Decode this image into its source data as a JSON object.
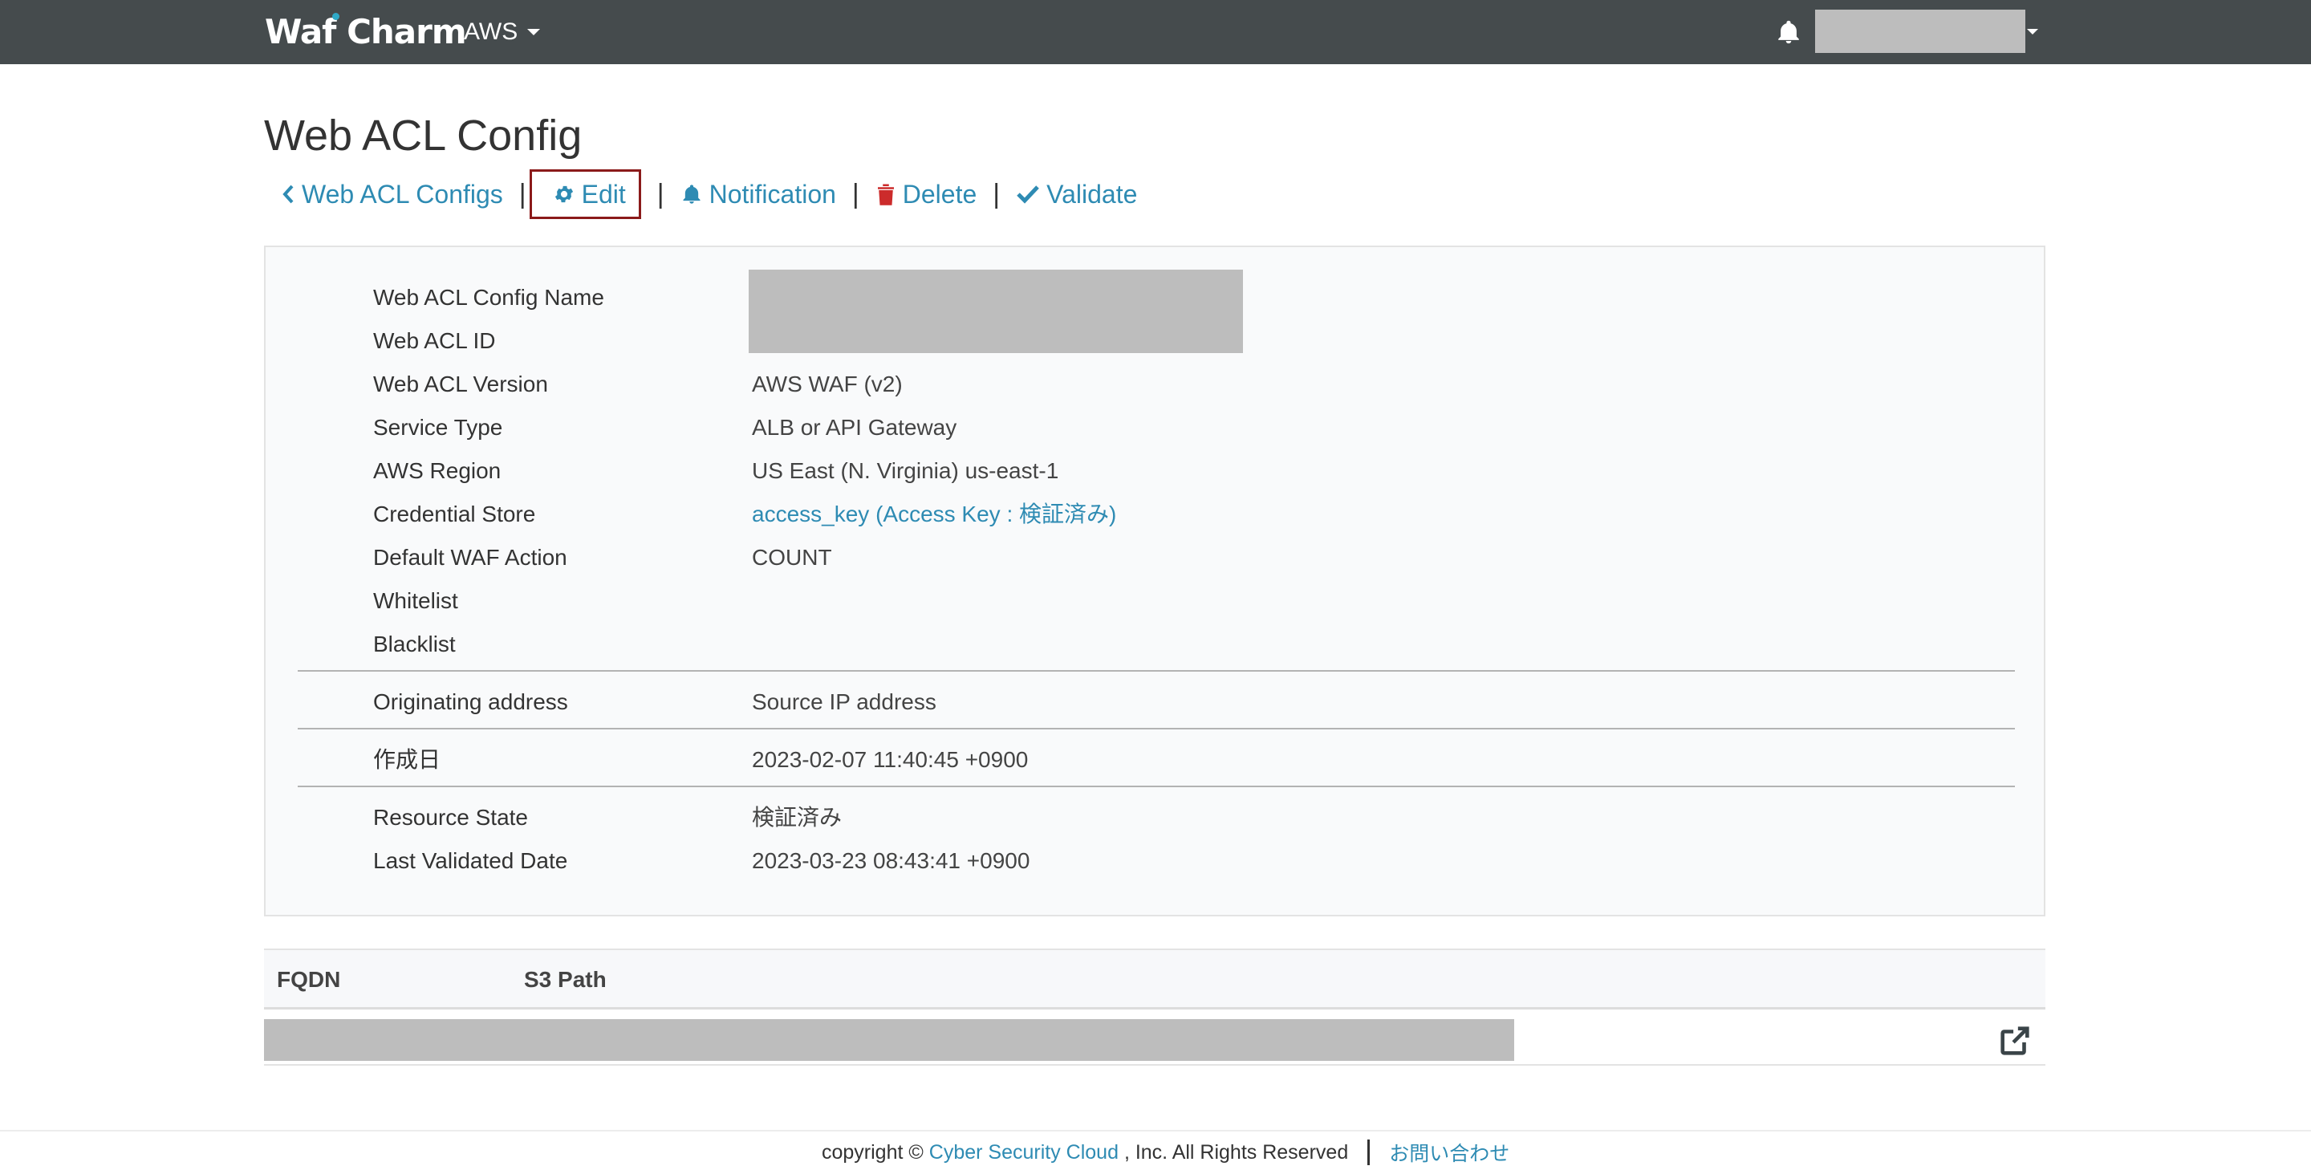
{
  "navbar": {
    "brand": "Waf Charm",
    "platform_dropdown": "AWS",
    "icons": {
      "notification": "bell-icon",
      "user_caret": "caret-down-icon"
    }
  },
  "page": {
    "title": "Web ACL Config"
  },
  "actions": {
    "back_label": "Web ACL Configs",
    "edit_label": "Edit",
    "notification_label": "Notification",
    "delete_label": "Delete",
    "validate_label": "Validate",
    "separator": "|"
  },
  "details": {
    "web_acl_config_name": {
      "label": "Web ACL Config Name"
    },
    "web_acl_id": {
      "label": "Web ACL ID"
    },
    "web_acl_version": {
      "label": "Web ACL Version",
      "value": "AWS WAF (v2)"
    },
    "service_type": {
      "label": "Service Type",
      "value": "ALB or API Gateway"
    },
    "aws_region": {
      "label": "AWS Region",
      "value": "US East (N. Virginia) us-east-1"
    },
    "credential_store": {
      "label": "Credential Store",
      "value": "access_key (Access Key : 検証済み)"
    },
    "default_waf_action": {
      "label": "Default WAF Action",
      "value": "COUNT"
    },
    "whitelist": {
      "label": "Whitelist"
    },
    "blacklist": {
      "label": "Blacklist"
    },
    "originating_address": {
      "label": "Originating address",
      "value": "Source IP address"
    },
    "created_at": {
      "label": "作成日",
      "value": "2023-02-07 11:40:45 +0900"
    },
    "resource_state": {
      "label": "Resource State",
      "value": "検証済み"
    },
    "last_validated": {
      "label": "Last Validated Date",
      "value": "2023-03-23 08:43:41 +0900"
    }
  },
  "fqdn_table": {
    "columns": [
      "FQDN",
      "S3 Path"
    ]
  },
  "footer": {
    "copyright_prefix": "copyright ©",
    "company_link": "Cyber Security Cloud",
    "copyright_suffix": ", Inc. All Rights Reserved",
    "contact_link": "お問い合わせ"
  },
  "colors": {
    "navbar_bg": "#454b4d",
    "link": "#2e8bb3",
    "edit_highlight_border": "#8b1a1a",
    "redaction": "#bdbdbd"
  }
}
